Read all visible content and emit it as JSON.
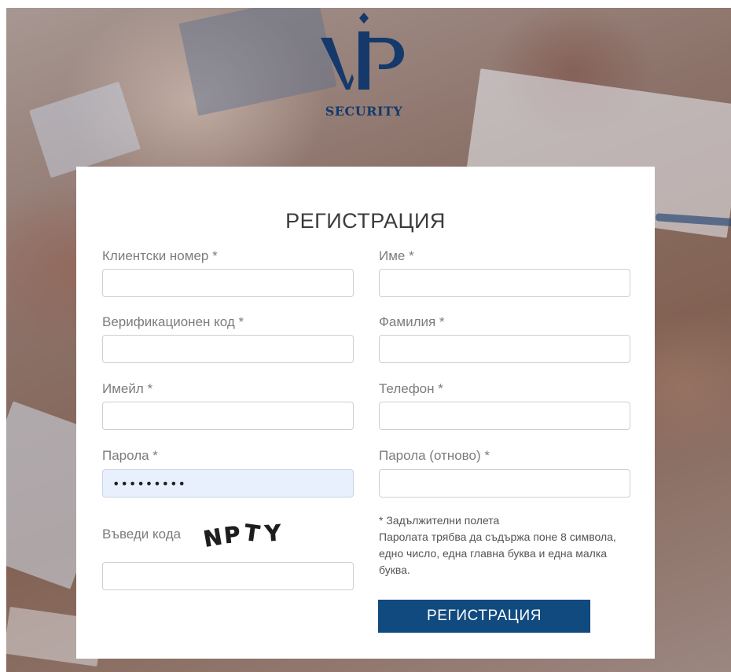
{
  "brand": {
    "wordmark": "SECURITY",
    "logo_icon": "vip-logo-icon"
  },
  "form": {
    "title": "РЕГИСТРАЦИЯ",
    "fields": {
      "client_number": {
        "label": "Клиентски номер *",
        "value": ""
      },
      "first_name": {
        "label": "Име *",
        "value": ""
      },
      "verification_code": {
        "label": "Верификационен код *",
        "value": ""
      },
      "last_name": {
        "label": "Фамилия *",
        "value": ""
      },
      "email": {
        "label": "Имейл *",
        "value": ""
      },
      "phone": {
        "label": "Телефон *",
        "value": ""
      },
      "password": {
        "label": "Парола *",
        "value_masked": "•••••••••"
      },
      "password_repeat": {
        "label": "Парола (отново) *",
        "value": ""
      }
    },
    "captcha": {
      "label": "Въведи кода",
      "image_text": "NPTY",
      "value": ""
    },
    "note": {
      "required": "* Задължителни полета",
      "password_rule": "Паролата трябва да съдържа поне 8 символа, едно число, една главна буква и една малка буква."
    },
    "submit_label": "РЕГИСТРАЦИЯ"
  },
  "colors": {
    "accent": "#114a7e",
    "logo": "#15396b",
    "autofill": "#e8f0fe"
  }
}
